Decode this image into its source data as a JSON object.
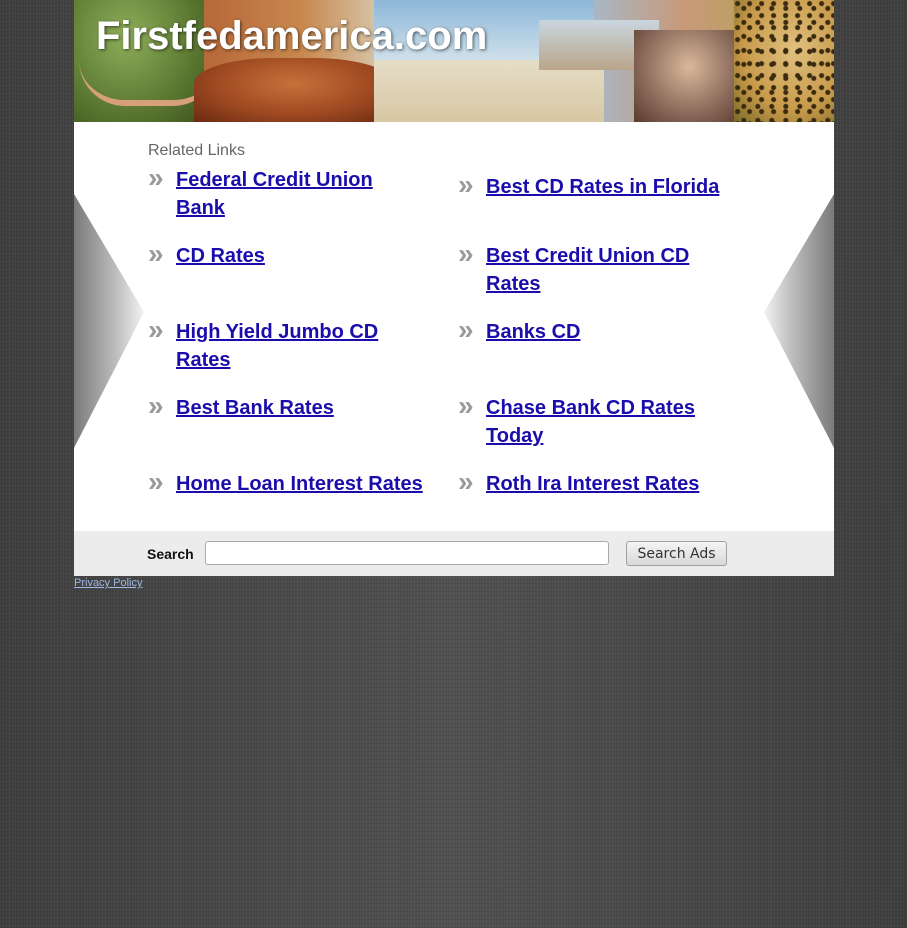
{
  "site": {
    "title": "Firstfedamerica.com"
  },
  "related": {
    "heading": "Related Links",
    "links": [
      {
        "label": "Federal Credit Union Bank"
      },
      {
        "label": "Best CD Rates in Florida"
      },
      {
        "label": "CD Rates"
      },
      {
        "label": "Best Credit Union CD Rates"
      },
      {
        "label": "High Yield Jumbo CD Rates"
      },
      {
        "label": "Banks CD"
      },
      {
        "label": "Best Bank Rates"
      },
      {
        "label": "Chase Bank CD Rates Today"
      },
      {
        "label": "Home Loan Interest Rates"
      },
      {
        "label": "Roth Ira Interest Rates"
      }
    ],
    "bullet_icon": "double-chevron-right-icon",
    "bullet_glyph": "»"
  },
  "search": {
    "label": "Search",
    "input_value": "",
    "button_label": "Search Ads"
  },
  "footer": {
    "privacy_label": "Privacy Policy"
  },
  "colors": {
    "link": "#1a0dab",
    "background": "#4a4a4a",
    "content_bg": "#ffffff",
    "search_bar_bg": "#ececec"
  }
}
